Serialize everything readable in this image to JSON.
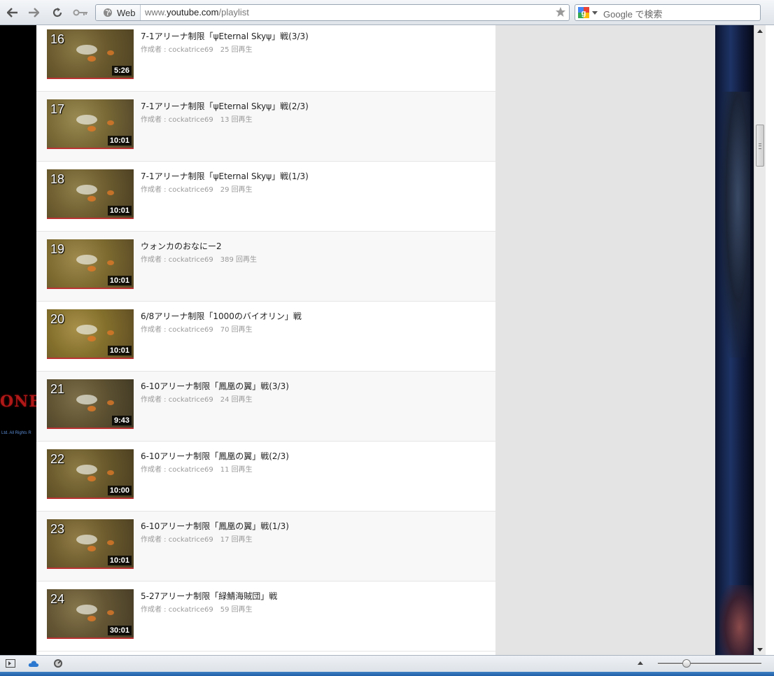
{
  "browser": {
    "address_chip": "Web",
    "url_prefix": "www.",
    "url_domain": "youtube.com",
    "url_path": "/playlist",
    "search_placeholder": "Google で検索"
  },
  "background_art": {
    "logo_text": "ONE",
    "copyright_fragment": "Ltd. All Rights R"
  },
  "playlist": {
    "items": [
      {
        "index": "16",
        "title": "7-1アリーナ制限「ψEternal Skyψ」戦(3/3)",
        "author": "作成者 : cockatrice69",
        "views": "25 回再生",
        "duration": "5:26"
      },
      {
        "index": "17",
        "title": "7-1アリーナ制限「ψEternal Skyψ」戦(2/3)",
        "author": "作成者 : cockatrice69",
        "views": "13 回再生",
        "duration": "10:01"
      },
      {
        "index": "18",
        "title": "7-1アリーナ制限「ψEternal Skyψ」戦(1/3)",
        "author": "作成者 : cockatrice69",
        "views": "29 回再生",
        "duration": "10:01"
      },
      {
        "index": "19",
        "title": "ウォンカのおなにー2",
        "author": "作成者 : cockatrice69",
        "views": "389 回再生",
        "duration": "10:01"
      },
      {
        "index": "20",
        "title": "6/8アリーナ制限「1000のバイオリン」戦",
        "author": "作成者 : cockatrice69",
        "views": "70 回再生",
        "duration": "10:01"
      },
      {
        "index": "21",
        "title": "6-10アリーナ制限「鳳凰の翼」戦(3/3)",
        "author": "作成者 : cockatrice69",
        "views": "24 回再生",
        "duration": "9:43"
      },
      {
        "index": "22",
        "title": "6-10アリーナ制限「鳳凰の翼」戦(2/3)",
        "author": "作成者 : cockatrice69",
        "views": "11 回再生",
        "duration": "10:00"
      },
      {
        "index": "23",
        "title": "6-10アリーナ制限「鳳凰の翼」戦(1/3)",
        "author": "作成者 : cockatrice69",
        "views": "17 回再生",
        "duration": "10:01"
      },
      {
        "index": "24",
        "title": "5-27アリーナ制限「緑鯖海賊団」戦",
        "author": "作成者 : cockatrice69",
        "views": "59 回再生",
        "duration": "30:01"
      }
    ]
  },
  "colors": {
    "thumb_border": "#b33333",
    "meta_text": "#999999",
    "right_panel": "#e4e4e4"
  }
}
